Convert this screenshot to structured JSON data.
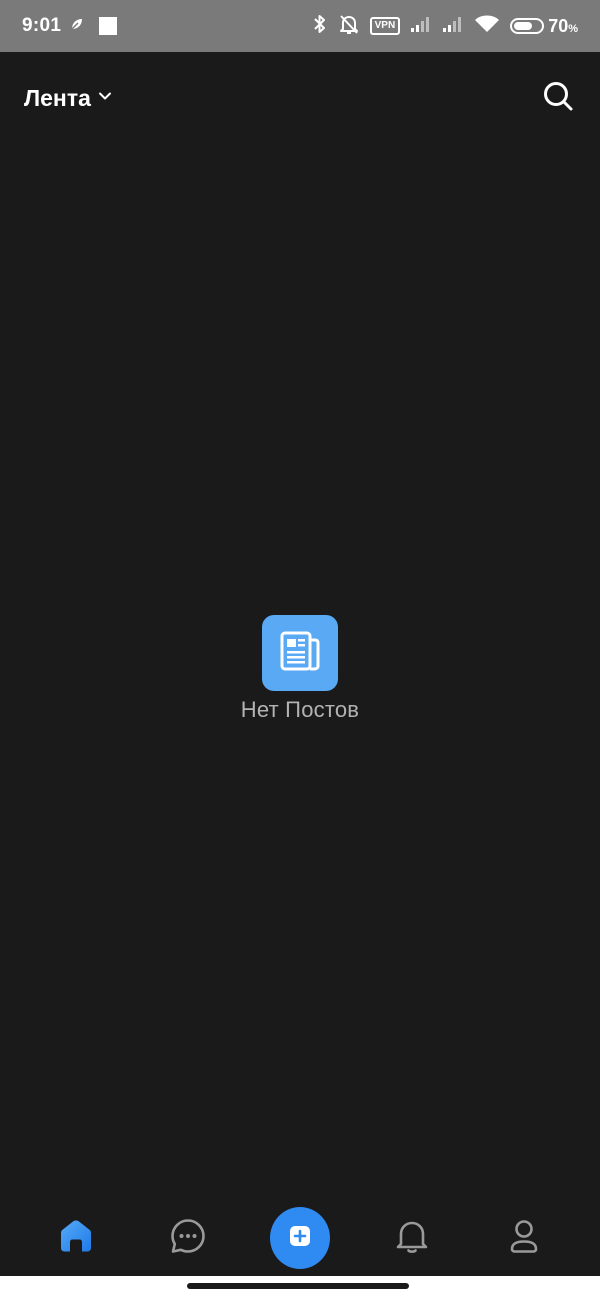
{
  "status_bar": {
    "time": "9:01",
    "vpn_label": "VPN",
    "battery_level": "70",
    "battery_unit": "%",
    "battery_fraction": 0.7
  },
  "header": {
    "title": "Лента",
    "dropdown_icon": "chevron-down-icon",
    "search_icon": "search-icon"
  },
  "empty_state": {
    "icon": "newspaper-icon",
    "message": "Нет Постов"
  },
  "bottom_nav": {
    "items": [
      {
        "id": "home",
        "icon": "home-icon",
        "active": true
      },
      {
        "id": "messages",
        "icon": "chat-bubble-icon",
        "active": false
      },
      {
        "id": "create",
        "icon": "plus-icon",
        "active": false
      },
      {
        "id": "notifications",
        "icon": "bell-icon",
        "active": false
      },
      {
        "id": "profile",
        "icon": "user-icon",
        "active": false
      }
    ]
  },
  "colors": {
    "background": "#1a1a1a",
    "status_bar": "#7a7a7a",
    "accent": "#2f8af2",
    "empty_icon_bg": "#5aa9f5",
    "inactive_icon": "#9a9a9a",
    "text_muted": "#b3b3b3"
  }
}
